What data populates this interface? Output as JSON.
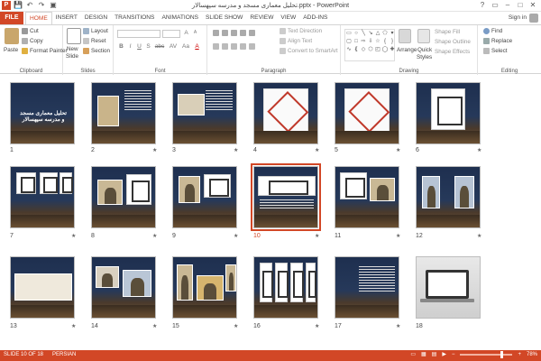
{
  "window": {
    "title": "تحلیل معماری مسجد و مدرسه سپهسالار.pptx - PowerPoint",
    "controls": [
      "?",
      "▭",
      "–",
      "□",
      "✕"
    ]
  },
  "quick_access": {
    "app_icon": "P",
    "save": "💾",
    "undo": "↶",
    "redo": "↷",
    "start": "▣"
  },
  "tabs": {
    "file": "FILE",
    "items": [
      "HOME",
      "INSERT",
      "DESIGN",
      "TRANSITIONS",
      "ANIMATIONS",
      "SLIDE SHOW",
      "REVIEW",
      "VIEW",
      "ADD-INS"
    ],
    "active": "HOME",
    "sign_in": "Sign in"
  },
  "ribbon": {
    "clipboard": {
      "paste": "Paste",
      "cut": "Cut",
      "copy": "Copy",
      "format_painter": "Format Painter",
      "label": "Clipboard"
    },
    "slides": {
      "new_slide": "New",
      "new_slide_2": "Slide",
      "layout": "Layout",
      "reset": "Reset",
      "section": "Section",
      "label": "Slides"
    },
    "font": {
      "bold": "B",
      "italic": "I",
      "underline": "U",
      "shadow": "S",
      "strike": "abc",
      "spacing": "AV",
      "case": "Aa",
      "color": "A",
      "grow": "A",
      "shrink": "A",
      "label": "Font"
    },
    "paragraph": {
      "text_direction": "Text Direction",
      "align_text": "Align Text",
      "smartart": "Convert to SmartArt",
      "label": "Paragraph"
    },
    "drawing": {
      "arrange": "Arrange",
      "quick_styles_1": "Quick",
      "quick_styles_2": "Styles",
      "shape_fill": "Shape Fill",
      "shape_outline": "Shape Outline",
      "shape_effects": "Shape Effects",
      "label": "Drawing"
    },
    "editing": {
      "find": "Find",
      "replace": "Replace",
      "select": "Select",
      "label": "Editing"
    }
  },
  "slides": [
    {
      "n": "1",
      "star": "",
      "selected": false
    },
    {
      "n": "2",
      "star": "★",
      "selected": false
    },
    {
      "n": "3",
      "star": "★",
      "selected": false
    },
    {
      "n": "4",
      "star": "★",
      "selected": false
    },
    {
      "n": "5",
      "star": "★",
      "selected": false
    },
    {
      "n": "6",
      "star": "★",
      "selected": false
    },
    {
      "n": "7",
      "star": "★",
      "selected": false
    },
    {
      "n": "8",
      "star": "★",
      "selected": false
    },
    {
      "n": "9",
      "star": "★",
      "selected": false
    },
    {
      "n": "10",
      "star": "★",
      "selected": true
    },
    {
      "n": "11",
      "star": "★",
      "selected": false
    },
    {
      "n": "12",
      "star": "★",
      "selected": false
    },
    {
      "n": "13",
      "star": "★",
      "selected": false
    },
    {
      "n": "14",
      "star": "★",
      "selected": false
    },
    {
      "n": "15",
      "star": "★",
      "selected": false
    },
    {
      "n": "16",
      "star": "★",
      "selected": false
    },
    {
      "n": "17",
      "star": "★",
      "selected": false
    },
    {
      "n": "18",
      "star": "",
      "selected": false
    }
  ],
  "slide1_title": "تحلیل معماری مسجد و مدرسه سپهسالار",
  "status": {
    "slide_of": "SLIDE 10 OF 18",
    "language": "PERSIAN",
    "zoom": "78%",
    "accent": "#d24726"
  }
}
